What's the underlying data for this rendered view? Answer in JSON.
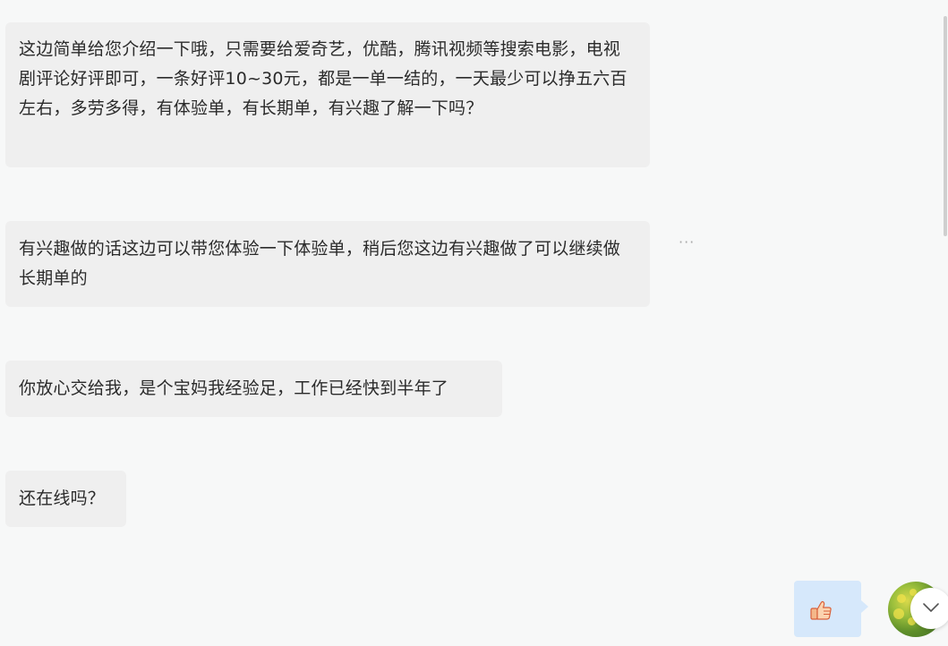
{
  "messages": [
    {
      "text": "这边简单给您介绍一下哦，只需要给爱奇艺，优酷，腾讯视频等搜索电影，电视剧评论好评即可，一条好评10~30元，都是一单一结的，一天最少可以挣五六百左右，多劳多得，有体验单，有长期单，有兴趣了解一下吗？"
    },
    {
      "text": "有兴趣做的话这边可以带您体验一下体验单，稍后您这边有兴趣做了可以继续做长期单的"
    },
    {
      "text": "你放心交给我，是个宝妈我经验足，工作已经快到半年了"
    },
    {
      "text": "还在线吗？"
    }
  ],
  "more_menu": {
    "label": "···"
  },
  "sent_message": {
    "icon": "thumbs-up-icon"
  },
  "colors": {
    "incoming_bubble": "#efefef",
    "outgoing_bubble": "#d6e8fb",
    "background": "#f7f8f8",
    "text": "#2b2b2b"
  }
}
